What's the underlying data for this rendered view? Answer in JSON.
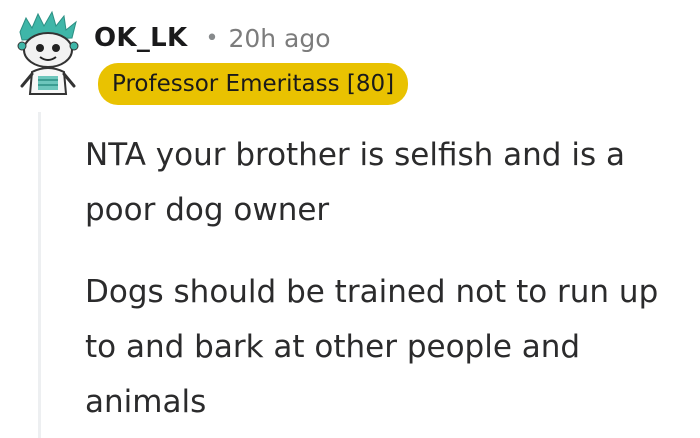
{
  "comment": {
    "username": "OK_LK",
    "separator": "•",
    "timestamp": "20h ago",
    "flair": "Professor Emeritass [80]",
    "paragraphs": [
      "NTA your brother is selfish and is a poor dog owner",
      "Dogs should be trained not to run up to and bark at other people and animals"
    ],
    "avatar_icon": "snoo-avatar-icon"
  },
  "colors": {
    "flair_background": "#e9c201",
    "thread_line": "#edeff1",
    "avatar_teal": "#3fb6a8"
  }
}
